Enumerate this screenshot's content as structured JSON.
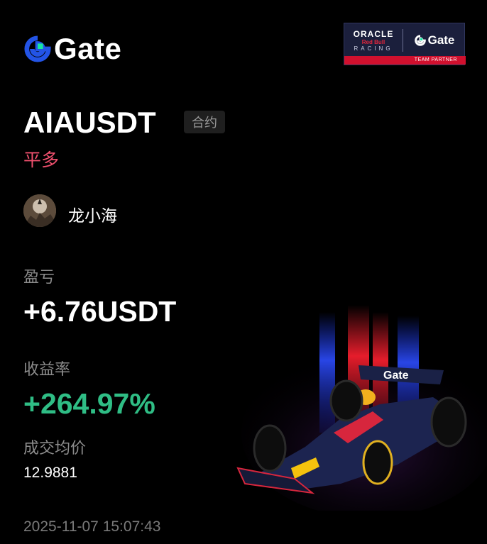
{
  "brand": {
    "name": "Gate",
    "logo_icon": "gate-logo-icon",
    "primary_color": "#2354e6",
    "accent_color": "#17e6a1"
  },
  "partner_badge": {
    "oracle": "ORACLE",
    "red_bull": "Red Bull",
    "racing": "RACING",
    "gate": "Gate",
    "footer": "TEAM PARTNER"
  },
  "position": {
    "symbol": "AIAUSDT",
    "type_tag": "合约",
    "side": "平多",
    "side_color": "#f0506e"
  },
  "user": {
    "name": "龙小海"
  },
  "stats": {
    "pnl_label": "盈亏",
    "pnl_value": "+6.76USDT",
    "roi_label": "收益率",
    "roi_value": "+264.97%",
    "roi_color": "#2fbd85",
    "avg_price_label": "成交均价",
    "avg_price_value": "12.9881"
  },
  "timestamp": "2025-11-07 15:07:43",
  "car_livery_text": "Gate"
}
